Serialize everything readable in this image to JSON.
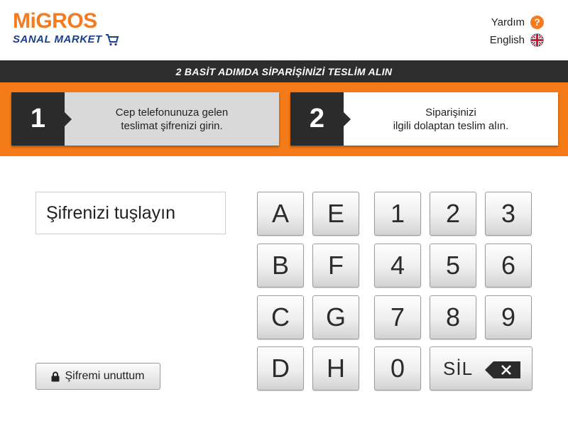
{
  "brand": {
    "name": "MiGROS",
    "sub": "SANAL MARKET"
  },
  "top_links": {
    "help": "Yardım",
    "language": "English"
  },
  "banner": {
    "title": "2 BASİT ADIMDA SİPARİŞİNİZİ TESLİM ALIN"
  },
  "steps": [
    {
      "number": "1",
      "line1": "Cep telefonunuza gelen",
      "line2": "teslimat şifrenizi girin."
    },
    {
      "number": "2",
      "line1": "Siparişinizi",
      "line2": "ilgili dolaptan teslim alın."
    }
  ],
  "password": {
    "placeholder": "Şifrenizi tuşlayın"
  },
  "forgot": {
    "label": "Şifremi unuttum"
  },
  "keypad": {
    "letters": [
      "A",
      "E",
      "B",
      "F",
      "C",
      "G",
      "D",
      "H"
    ],
    "digits": [
      "1",
      "2",
      "3",
      "4",
      "5",
      "6",
      "7",
      "8",
      "9",
      "0"
    ],
    "delete_label": "SİL"
  },
  "colors": {
    "accent": "#f57a18",
    "dark": "#2d2d2d",
    "brand_blue": "#1b3f8f"
  }
}
